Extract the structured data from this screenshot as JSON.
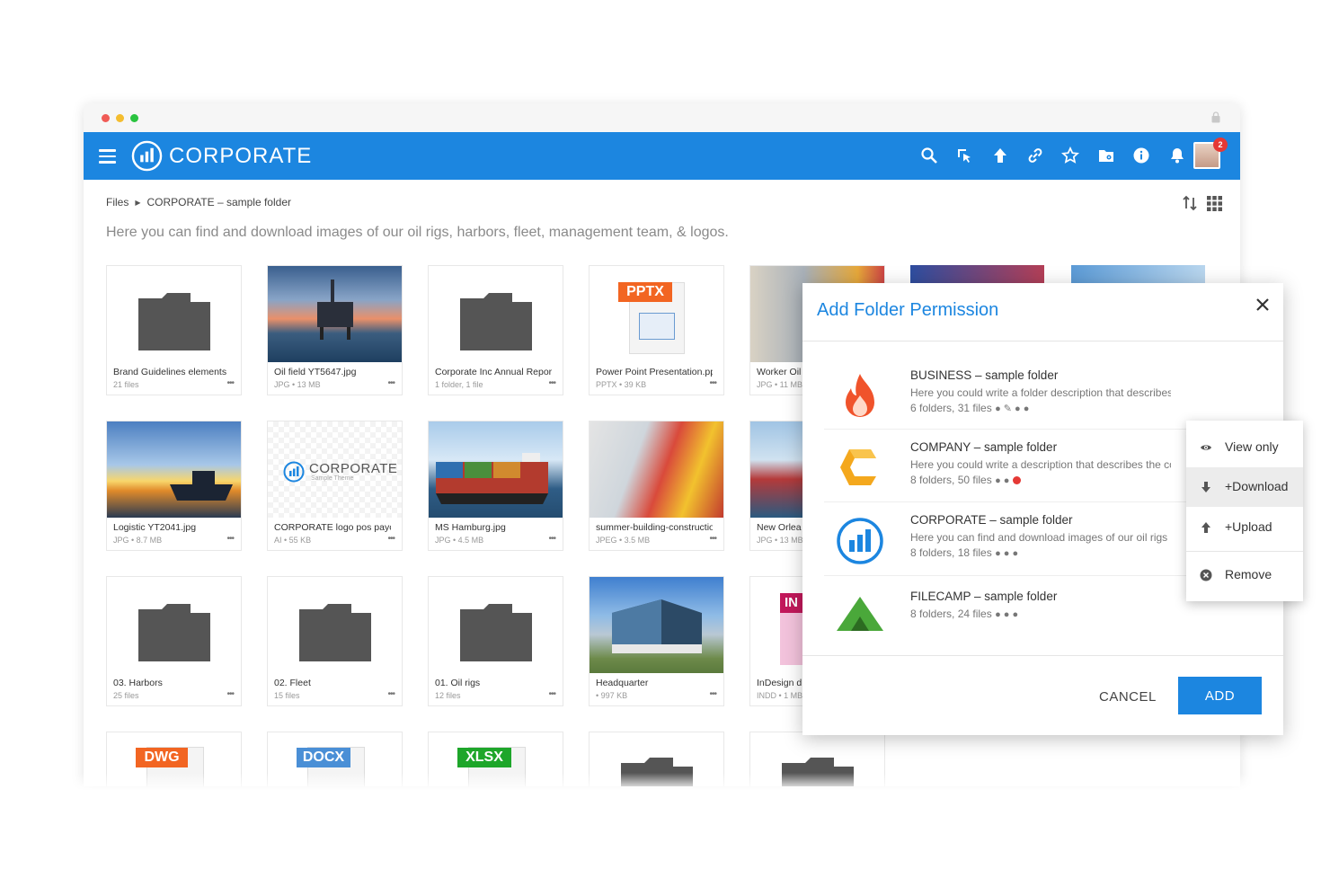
{
  "app": {
    "brand": "CORPORATE"
  },
  "breadcrumb": {
    "root": "Files",
    "current": "CORPORATE – sample folder"
  },
  "description": "Here you can find and download images of our oil rigs, harbors, fleet, management team, & logos.",
  "cards": [
    {
      "name": "Brand Guidelines elements",
      "meta": "21 files",
      "kind": "folder"
    },
    {
      "name": "Oil field YT5647.jpg",
      "meta": "JPG • 13 MB",
      "kind": "image"
    },
    {
      "name": "Corporate Inc Annual Report",
      "meta": "1 folder, 1 file",
      "kind": "folder"
    },
    {
      "name": "Power Point Presentation.pptx",
      "meta": "PPTX • 39 KB",
      "kind": "doc",
      "badge": "PPTX"
    },
    {
      "name": "Worker Oil",
      "meta": "JPG • 11 MB",
      "kind": "image"
    },
    {
      "name": "Logistic YT2041.jpg",
      "meta": "JPG • 8.7 MB",
      "kind": "image"
    },
    {
      "name": "CORPORATE logo pos payoff",
      "meta": "AI • 55 KB",
      "kind": "logo"
    },
    {
      "name": "MS Hamburg.jpg",
      "meta": "JPG • 4.5 MB",
      "kind": "image"
    },
    {
      "name": "summer-building-construction",
      "meta": "JPEG • 3.5 MB",
      "kind": "image"
    },
    {
      "name": "New Orlea",
      "meta": "JPG • 13 MB",
      "kind": "image"
    },
    {
      "name": "03. Harbors",
      "meta": "25 files",
      "kind": "folder"
    },
    {
      "name": "02. Fleet",
      "meta": "15 files",
      "kind": "folder"
    },
    {
      "name": "01. Oil rigs",
      "meta": "12 files",
      "kind": "folder"
    },
    {
      "name": "Headquarter",
      "meta": "• 997 KB",
      "kind": "image"
    },
    {
      "name": "InDesign d",
      "meta": "INDD • 1 MB",
      "kind": "doc",
      "badge": "IN"
    }
  ],
  "bottom_badges": [
    "DWG",
    "DOCX",
    "XLSX"
  ],
  "logo_card": {
    "word": "CORPORATE",
    "tagline": "Sample Theme"
  },
  "more_glyph": "•••",
  "dialog": {
    "title": "Add Folder Permission",
    "folders": [
      {
        "title": "BUSINESS – sample folder",
        "desc": "Here you could write a folder description that describes the content of",
        "stats": "6 folders, 31 files"
      },
      {
        "title": "COMPANY – sample folder",
        "desc": "Here you could write a description that describes the content",
        "stats": "8 folders, 50 files"
      },
      {
        "title": "CORPORATE – sample folder",
        "desc": "Here you can find and download images of our oil rigs",
        "stats": "8 folders, 18 files"
      },
      {
        "title": "FILECAMP – sample folder",
        "desc": "",
        "stats": "8 folders, 24 files"
      }
    ],
    "cancel_label": "CANCEL",
    "add_label": "ADD"
  },
  "menu": {
    "items": [
      {
        "label": "View only"
      },
      {
        "label": "+Download"
      },
      {
        "label": "+Upload"
      },
      {
        "label": "Remove"
      }
    ]
  },
  "notifications": {
    "count": "2"
  },
  "colors": {
    "primary": "#1c86e0",
    "folder": "#555555"
  }
}
